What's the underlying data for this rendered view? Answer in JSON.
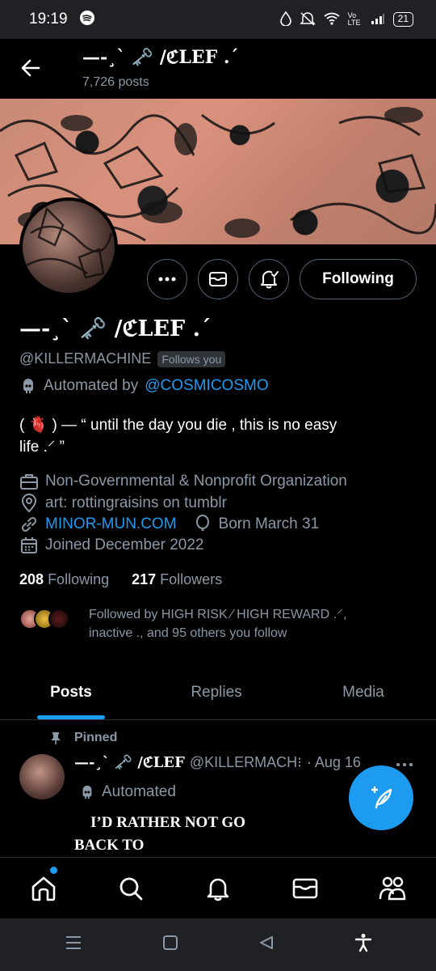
{
  "status_bar": {
    "time": "19:19",
    "network": "Vo LTE",
    "battery": "21"
  },
  "header": {
    "title": "—-¸` 🗝️ /ℭLEF .´",
    "posts_count": "7,726 posts"
  },
  "profile": {
    "display_name": "—-¸` 🗝️ /ℭLEF .´",
    "handle": "@KILLERMACHINE",
    "follows_you": "Follows you",
    "automated_by_label": "Automated by",
    "automated_by_handle": "@COSMICOSMO",
    "bio_line1": "( 🫀 )  —   “ until the day you die , this is no easy",
    "bio_line2": "life .⸍   ”",
    "category": "Non-Governmental & Nonprofit Organization",
    "location": "art: rottingraisins on tumblr",
    "website": "MINOR-MUN.COM",
    "birthday": "Born March 31",
    "joined": "Joined December 2022",
    "following_count": "208",
    "following_label": "Following",
    "followers_count": "217",
    "followers_label": "Followers",
    "followed_by_line1": "Followed by HIGH RISK ⁄ HIGH REWARD .⸍,",
    "followed_by_line2": "inactive ., and 95 others you follow"
  },
  "actions": {
    "follow_state": "Following"
  },
  "tabs": [
    {
      "label": "Posts",
      "active": true
    },
    {
      "label": "Replies",
      "active": false
    },
    {
      "label": "Media",
      "active": false
    }
  ],
  "pinned_post": {
    "pinned_label": "Pinned",
    "name": "—-¸` 🗝️ /ℭLEF",
    "handle": "@KILLERMACH⁝",
    "date": "· Aug 16",
    "automated_label": "Automated",
    "text_line1": "I’D RATHER NOT GO",
    "text_line2": "BACK TO"
  },
  "colors": {
    "accent": "#1d9bf0",
    "muted": "#8b98a5",
    "background": "#000000"
  }
}
